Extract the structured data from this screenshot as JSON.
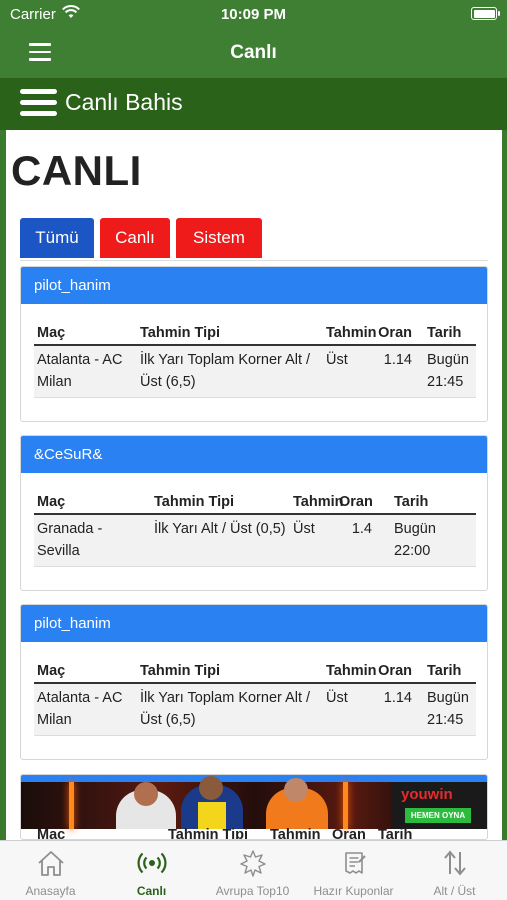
{
  "status_bar": {
    "carrier": "Carrier",
    "time": "10:09 PM"
  },
  "nav": {
    "title": "Canlı"
  },
  "section": {
    "title": "Canlı Bahis"
  },
  "page": {
    "heading": "CANLI"
  },
  "tabs": [
    "Tümü",
    "Canlı",
    "Sistem"
  ],
  "columns": [
    "Maç",
    "Tahmin Tipi",
    "Tahmin",
    "Oran",
    "Tarih"
  ],
  "cards": [
    {
      "user": "pilot_hanim",
      "match": "Atalanta - AC Milan",
      "type": "İlk Yarı Toplam Korner Alt / Üst (6,5)",
      "prediction": "Üst",
      "odds": "1.14",
      "date": "Bugün 21:45"
    },
    {
      "user": "&CeSuR&",
      "match": "Granada - Sevilla",
      "type": "İlk Yarı Alt / Üst (0,5)",
      "prediction": "Üst",
      "odds": "1.4",
      "date": "Bugün 22:00"
    },
    {
      "user": "pilot_hanim",
      "match": "Atalanta - AC Milan",
      "type": "İlk Yarı Toplam Korner Alt / Üst (6,5)",
      "prediction": "Üst",
      "odds": "1.14",
      "date": "Bugün 21:45"
    }
  ],
  "banner": {
    "brand": "youwin",
    "cta": "HEMEN OYNA"
  },
  "tabbar": [
    {
      "label": "Anasayfa",
      "icon": "home-icon"
    },
    {
      "label": "Canlı",
      "icon": "live-broadcast-icon"
    },
    {
      "label": "Avrupa Top10",
      "icon": "star-burst-icon"
    },
    {
      "label": "Hazır Kuponlar",
      "icon": "coupon-icon"
    },
    {
      "label": "Alt / Üst",
      "icon": "up-down-arrows-icon"
    }
  ],
  "colors": {
    "header_green": "#3f7f34",
    "section_green": "#2a6219",
    "tab_blue": "#1c55c4",
    "tab_red": "#ef1b1b",
    "card_header_blue": "#2a81f2"
  }
}
